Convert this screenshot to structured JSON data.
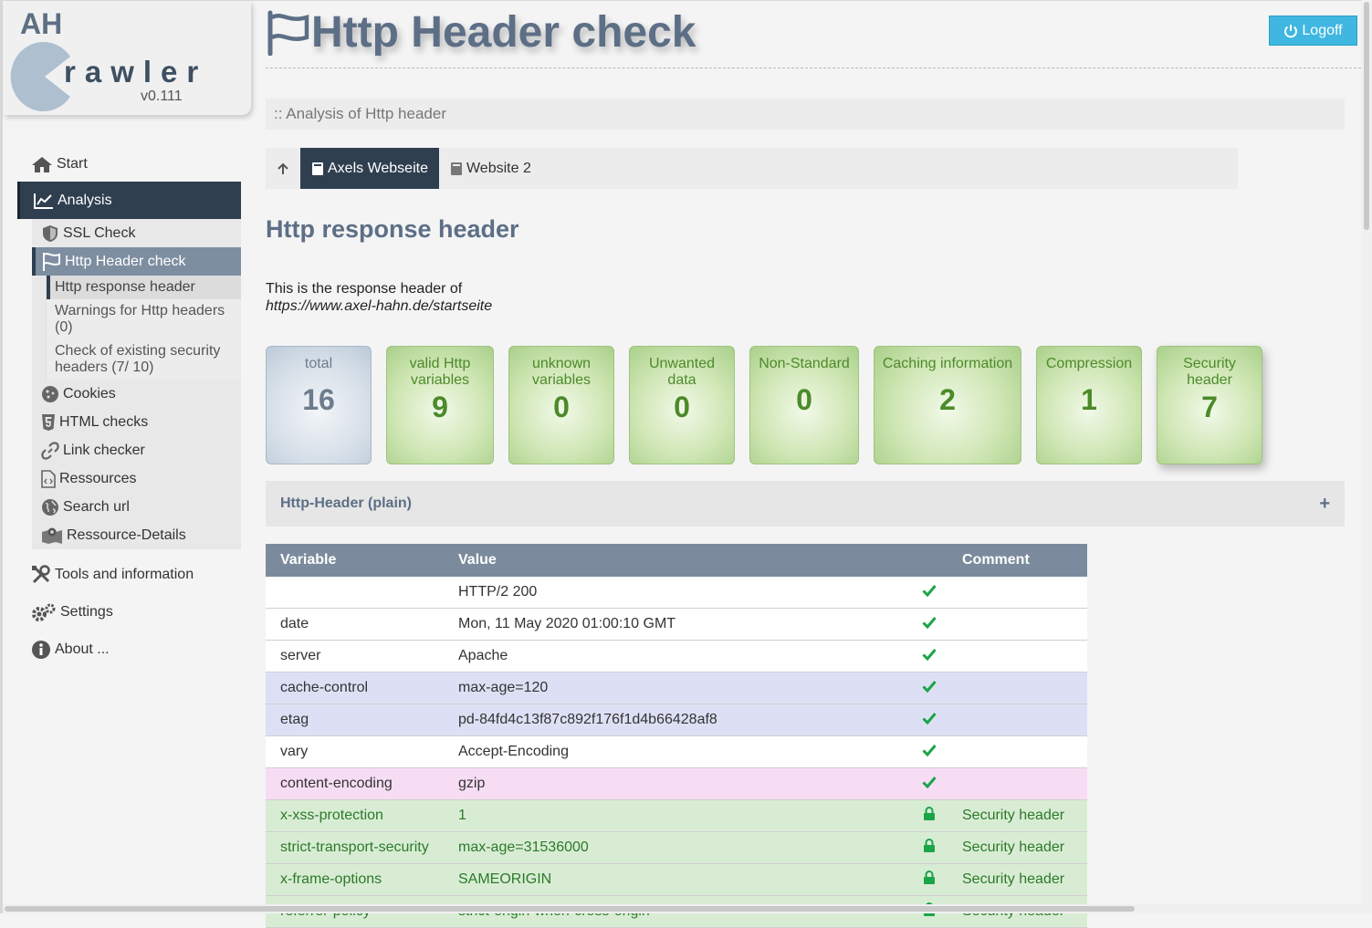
{
  "app": {
    "logo_prefix": "AH",
    "logo_word": "rawler",
    "version": "v0.111"
  },
  "header": {
    "title": "Http Header check",
    "logoff_label": "Logoff",
    "subtitle": ":: Analysis of Http header"
  },
  "sidebar": {
    "start": "Start",
    "analysis": "Analysis",
    "ssl_check": "SSL Check",
    "http_header_check": "Http Header check",
    "sub_response": "Http response header",
    "sub_warnings": "Warnings for Http headers (0)",
    "sub_security": "Check of existing security headers (7/ 10)",
    "cookies": "Cookies",
    "html_checks": "HTML checks",
    "link_checker": "Link checker",
    "ressources": "Ressources",
    "search_url": "Search url",
    "resource_details": "Ressource-Details",
    "tools": "Tools and information",
    "settings": "Settings",
    "about": "About ..."
  },
  "tabs": {
    "site1": "Axels Webseite",
    "site2": "Website 2"
  },
  "main": {
    "section_title": "Http response header",
    "intro_text": "This is the response header of",
    "intro_url": "https://www.axel-hahn.de/startseite",
    "accordion_label": "Http-Header (plain)",
    "accordion_icon": "+"
  },
  "tiles": [
    {
      "label": "total",
      "value": "16"
    },
    {
      "label": "valid Http variables",
      "value": "9"
    },
    {
      "label": "unknown variables",
      "value": "0"
    },
    {
      "label": "Unwanted data",
      "value": "0"
    },
    {
      "label": "Non-Standard",
      "value": "0"
    },
    {
      "label": "Caching information",
      "value": "2"
    },
    {
      "label": "Compression",
      "value": "1"
    },
    {
      "label": "Security header",
      "value": "7"
    }
  ],
  "table": {
    "columns": [
      "Variable",
      "Value",
      "Comment"
    ],
    "rows": [
      {
        "variable": "",
        "value": "HTTP/2 200",
        "icon": "check",
        "comment": ""
      },
      {
        "variable": "date",
        "value": "Mon, 11 May 2020 01:00:10 GMT",
        "icon": "check",
        "comment": ""
      },
      {
        "variable": "server",
        "value": "Apache",
        "icon": "check",
        "comment": ""
      },
      {
        "variable": "cache-control",
        "value": "max-age=120",
        "icon": "check",
        "comment": ""
      },
      {
        "variable": "etag",
        "value": "pd-84fd4c13f87c892f176f1d4b66428af8",
        "icon": "check",
        "comment": ""
      },
      {
        "variable": "vary",
        "value": "Accept-Encoding",
        "icon": "check",
        "comment": ""
      },
      {
        "variable": "content-encoding",
        "value": "gzip",
        "icon": "check",
        "comment": ""
      },
      {
        "variable": "x-xss-protection",
        "value": "1",
        "icon": "lock",
        "comment": "Security header"
      },
      {
        "variable": "strict-transport-security",
        "value": "max-age=31536000",
        "icon": "lock",
        "comment": "Security header"
      },
      {
        "variable": "x-frame-options",
        "value": "SAMEORIGIN",
        "icon": "lock",
        "comment": "Security header"
      },
      {
        "variable": "referrer-policy",
        "value": "strict-origin-when-cross-origin",
        "icon": "lock",
        "comment": "Security header"
      }
    ]
  },
  "colors": {
    "nav_dark": "#2f3f50",
    "title": "#5d6f86",
    "accent_blue": "#3fb7e1",
    "ok_green": "#1aa548"
  }
}
